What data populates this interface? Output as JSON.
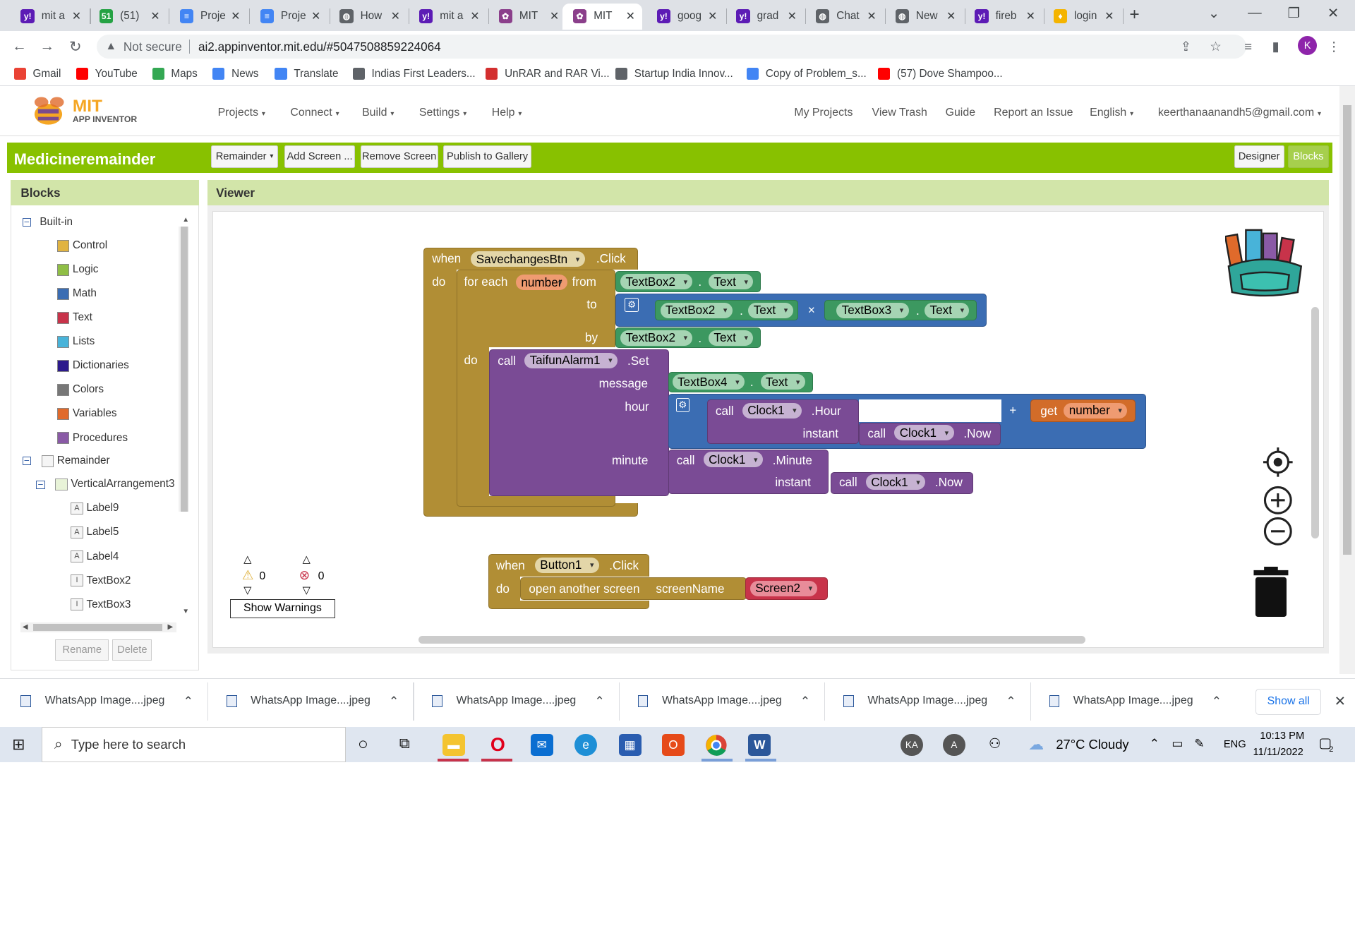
{
  "browser": {
    "tabs": [
      {
        "label": "mit a",
        "fav": "y!",
        "color": "#5c1bb5"
      },
      {
        "label": "(51) ",
        "fav": "51",
        "color": "#25a244"
      },
      {
        "label": "Proje",
        "fav": "≡",
        "color": "#4285f4"
      },
      {
        "label": "Proje",
        "fav": "≡",
        "color": "#4285f4"
      },
      {
        "label": "How ",
        "fav": "◍",
        "color": "#5f6368"
      },
      {
        "label": "mit a",
        "fav": "y!",
        "color": "#5c1bb5"
      },
      {
        "label": "MIT ",
        "fav": "✿",
        "color": "#8b3f8b"
      },
      {
        "label": "MIT ",
        "fav": "✿",
        "color": "#8b3f8b"
      },
      {
        "label": "goog",
        "fav": "y!",
        "color": "#5c1bb5"
      },
      {
        "label": "grad",
        "fav": "y!",
        "color": "#5c1bb5"
      },
      {
        "label": "Chat ",
        "fav": "◍",
        "color": "#5f6368"
      },
      {
        "label": "New ",
        "fav": "◍",
        "color": "#5f6368"
      },
      {
        "label": "fireb",
        "fav": "y!",
        "color": "#5c1bb5"
      },
      {
        "label": "login",
        "fav": "♦",
        "color": "#f4b400"
      }
    ],
    "url": "ai2.appinventor.mit.edu/#5047508859224064",
    "not_secure": "Not secure",
    "avatar_letter": "K",
    "bookmarks": [
      "Gmail",
      "YouTube",
      "Maps",
      "News",
      "Translate",
      "Indias First Leaders...",
      "UnRAR and RAR Vi...",
      "Startup India Innov...",
      "Copy of Problem_s...",
      "(57) Dove Shampoo..."
    ]
  },
  "ai": {
    "logo_mit": "MIT",
    "logo_sub": "APP INVENTOR",
    "menu": [
      "Projects",
      "Connect",
      "Build",
      "Settings",
      "Help"
    ],
    "right_menu": [
      "My Projects",
      "View Trash",
      "Guide",
      "Report an Issue",
      "English",
      "keerthanaanandh5@gmail.com"
    ],
    "project_name": "Medicineremainder",
    "screen_dropdown": "Remainder",
    "add_screen": "Add Screen ...",
    "remove_screen": "Remove Screen",
    "publish": "Publish to Gallery",
    "designer": "Designer",
    "blocks_btn": "Blocks"
  },
  "blocks_panel": {
    "title": "Blocks",
    "builtin": "Built-in",
    "categories": [
      {
        "label": "Control",
        "color": "#e0b341"
      },
      {
        "label": "Logic",
        "color": "#8fbe45"
      },
      {
        "label": "Math",
        "color": "#3b6db3"
      },
      {
        "label": "Text",
        "color": "#c8334a"
      },
      {
        "label": "Lists",
        "color": "#48b3d9"
      },
      {
        "label": "Dictionaries",
        "color": "#2c1a8c"
      },
      {
        "label": "Colors",
        "color": "#777777"
      },
      {
        "label": "Variables",
        "color": "#e06a2b"
      },
      {
        "label": "Procedures",
        "color": "#8a5aa6"
      }
    ],
    "screen": "Remainder",
    "arrangement": "VerticalArrangement3",
    "components": [
      {
        "label": "Label9",
        "icon": "A"
      },
      {
        "label": "Label5",
        "icon": "A"
      },
      {
        "label": "Label4",
        "icon": "A"
      },
      {
        "label": "TextBox2",
        "icon": "I"
      },
      {
        "label": "TextBox3",
        "icon": "I"
      }
    ],
    "rename": "Rename",
    "delete": "Delete"
  },
  "viewer": {
    "title": "Viewer",
    "event1": {
      "when": "when",
      "component": "SavechangesBtn",
      "event": ".Click",
      "do": "do",
      "foreach": "for each",
      "var": "number",
      "from": "from",
      "to": "to",
      "by": "by",
      "do2": "do",
      "tb2": "TextBox2",
      "text": "Text",
      "dot": ".",
      "tb3": "TextBox3",
      "times": "×",
      "call": "call",
      "alarm": "TaifunAlarm1",
      "set": ".Set",
      "message": "message",
      "hour": "hour",
      "minute": "minute",
      "tb4": "TextBox4",
      "clock": "Clock1",
      "hour_m": ".Hour",
      "minute_m": ".Minute",
      "instant": "instant",
      "now": ".Now",
      "plus": "+",
      "get": "get"
    },
    "event2": {
      "when": "when",
      "component": "Button1",
      "event": ".Click",
      "do": "do",
      "open": "open another screen",
      "screenName": "screenName",
      "screen": "Screen2"
    },
    "warnings": "0",
    "errors": "0",
    "show_warnings": "Show Warnings"
  },
  "downloads": {
    "items": [
      "WhatsApp Image....jpeg",
      "WhatsApp Image....jpeg",
      "WhatsApp Image....jpeg",
      "WhatsApp Image....jpeg",
      "WhatsApp Image....jpeg",
      "WhatsApp Image....jpeg"
    ],
    "show_all": "Show all"
  },
  "taskbar": {
    "search_placeholder": "Type here to search",
    "user1": "KA",
    "user2": "A",
    "weather": "27°C  Cloudy",
    "lang": "ENG",
    "time": "10:13 PM",
    "date": "11/11/2022",
    "notif_count": "2"
  }
}
